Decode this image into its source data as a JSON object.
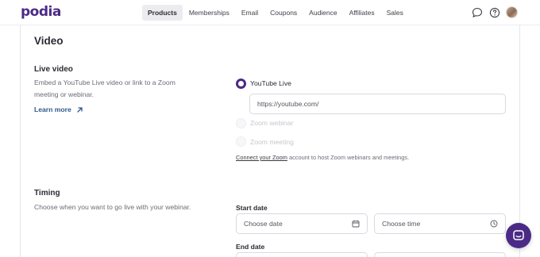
{
  "header": {
    "logo": "podia",
    "nav": [
      "Products",
      "Memberships",
      "Email",
      "Coupons",
      "Audience",
      "Affiliates",
      "Sales"
    ],
    "active_nav": "Products"
  },
  "video_section": {
    "title": "Video"
  },
  "live_video": {
    "heading": "Live video",
    "description": "Embed a YouTube Live video or link to a Zoom meeting or webinar.",
    "learn_more": "Learn more",
    "options": [
      {
        "label": "YouTube Live",
        "selected": true,
        "disabled": false
      },
      {
        "label": "Zoom webinar",
        "selected": false,
        "disabled": true
      },
      {
        "label": "Zoom meeting",
        "selected": false,
        "disabled": true
      }
    ],
    "youtube_placeholder": "https://youtube.com/",
    "zoom_note_link": "Connect your Zoom",
    "zoom_note_rest": " account to host Zoom webinars and meetings."
  },
  "timing": {
    "heading": "Timing",
    "description": "Choose when you want to go live with your webinar.",
    "start_label": "Start date",
    "start_date_placeholder": "Choose date",
    "start_time_placeholder": "Choose time",
    "end_label": "End date"
  },
  "colors": {
    "brand": "#4b2a86",
    "link": "#2d5a8c"
  },
  "icons": [
    "chat-bubble-icon",
    "help-icon",
    "calendar-icon",
    "clock-icon",
    "arrow-up-right-icon",
    "messenger-icon"
  ]
}
